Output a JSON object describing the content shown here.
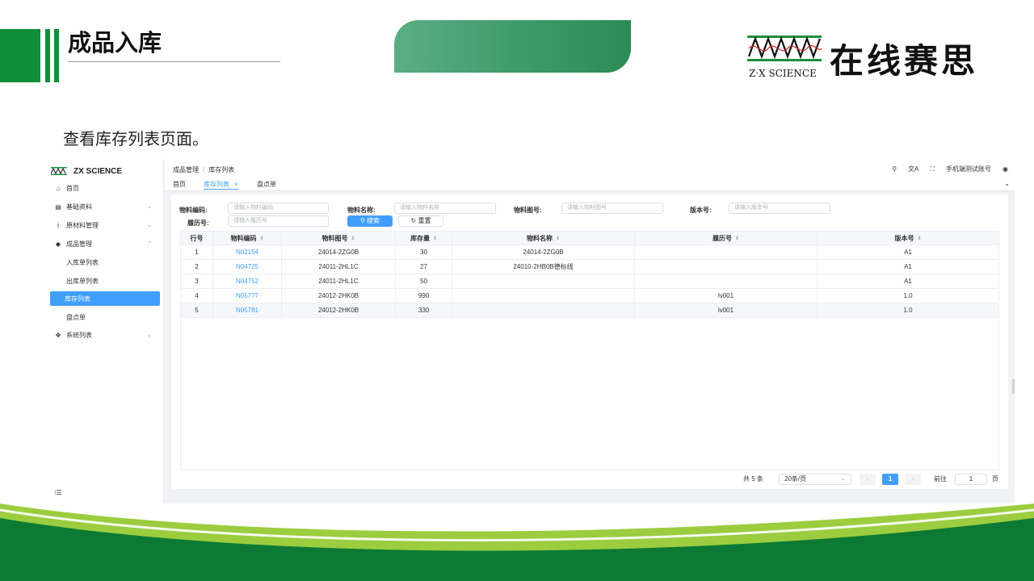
{
  "slide": {
    "title": "成品入库",
    "subtitle": "查看库存列表页面。",
    "logo_en": "Z·X SCIENCE",
    "logo_cn": "在线赛思",
    "colors": {
      "brand_green": "#0f8f3a",
      "accent_blue": "#409eff"
    }
  },
  "app": {
    "brand": "ZX SCIENCE",
    "sidebar": {
      "items": [
        {
          "label": "首页",
          "icon": "home-icon"
        },
        {
          "label": "基础资料",
          "icon": "database-icon",
          "arrow": "⌄"
        },
        {
          "label": "原材料管理",
          "icon": "branch-icon",
          "arrow": "⌄"
        },
        {
          "label": "成品管理",
          "icon": "cube-icon",
          "arrow": "⌃"
        },
        {
          "label": "入库单列表"
        },
        {
          "label": "出库单列表"
        },
        {
          "label": "库存列表"
        },
        {
          "label": "盘点单"
        },
        {
          "label": "系统列表",
          "icon": "gear-icon",
          "arrow": "⌄"
        }
      ]
    },
    "breadcrumb": {
      "parent": "成品管理",
      "sep": "/",
      "current": "库存列表"
    },
    "header": {
      "account": "手机端测试账号"
    },
    "tabs": [
      {
        "label": "首页"
      },
      {
        "label": "库存列表",
        "close": "×"
      },
      {
        "label": "盘点单"
      }
    ],
    "filters": {
      "material_code": {
        "label": "物料编码:",
        "placeholder": "请输入物料编码"
      },
      "material_name": {
        "label": "物料名称:",
        "placeholder": "请输入物料名称"
      },
      "material_drawing": {
        "label": "物料图号:",
        "placeholder": "请输入物料图号"
      },
      "version": {
        "label": "版本号:",
        "placeholder": "请输入版本号"
      },
      "resume": {
        "label": "履历号:",
        "placeholder": "请输入履历号"
      },
      "search_label": "搜索",
      "reset_label": "重置"
    },
    "table": {
      "columns": [
        "行号",
        "物料编码",
        "物料图号",
        "库存量",
        "物料名称",
        "履历号",
        "版本号"
      ],
      "rows": [
        [
          "1",
          "N02154",
          "24014-2ZG0B",
          "30",
          "24014-2ZG0B",
          "",
          "A1"
        ],
        [
          "2",
          "N04725",
          "24011-2HL1C",
          "27",
          "24010-2HB0B德标线",
          "",
          "A1"
        ],
        [
          "3",
          "N04752",
          "24011-2HL1C",
          "50",
          "",
          "",
          "A1"
        ],
        [
          "4",
          "N05777",
          "24012-2HK0B",
          "990",
          "",
          "lv001",
          "1.0"
        ],
        [
          "5",
          "N05781",
          "24012-2HK0B",
          "330",
          "",
          "lv001",
          "1.0"
        ]
      ]
    },
    "pagination": {
      "total": "共 5 条",
      "page_size": "20条/页",
      "current_page": "1",
      "goto_label": "前往",
      "goto_value": "1",
      "page_unit": "页"
    }
  }
}
